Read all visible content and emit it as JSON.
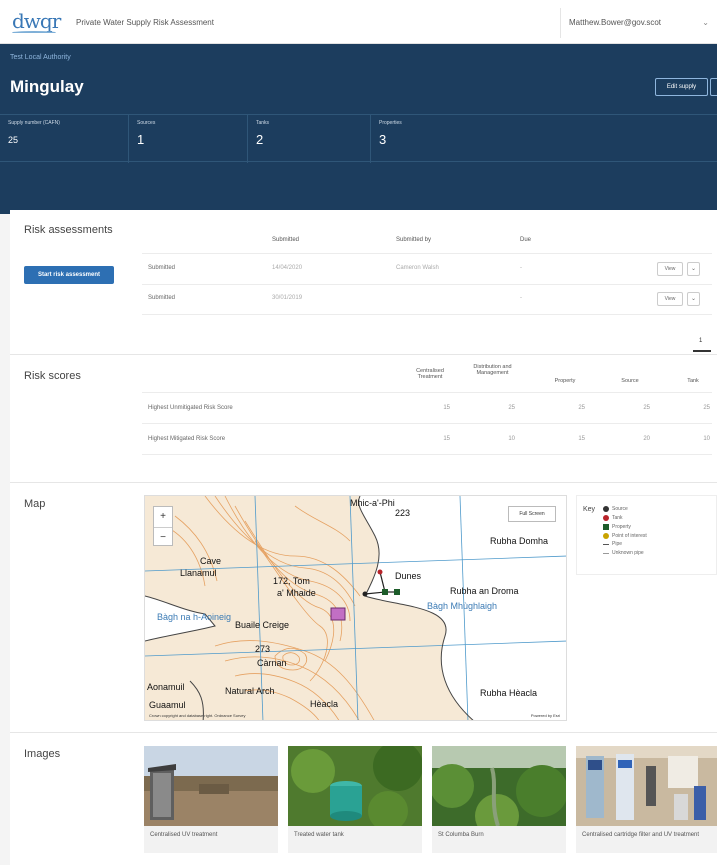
{
  "topbar": {
    "logo": "dwqr",
    "title": "Private Water Supply Risk Assessment",
    "user_email": "Matthew.Bower@gov.scot",
    "chevron": "⌄"
  },
  "header": {
    "authority": "Test Local Authority",
    "supply_name": "Mingulay",
    "edit_label": "Edit supply",
    "stats": [
      {
        "label": "Supply number (CAFN)",
        "value": "25"
      },
      {
        "label": "Sources",
        "value": "1"
      },
      {
        "label": "Tanks",
        "value": "2"
      },
      {
        "label": "Properties",
        "value": "3"
      }
    ]
  },
  "risk_assessments": {
    "title": "Risk assessments",
    "start_label": "Start risk assessment",
    "columns": [
      "Submitted",
      "Submitted by",
      "Due"
    ],
    "rows": [
      {
        "status": "Submitted",
        "submitted": "14/04/2020",
        "by": "Cameron Walsh",
        "due": "-"
      },
      {
        "status": "Submitted",
        "submitted": "30/01/2019",
        "by": "",
        "due": "-"
      }
    ],
    "view_label": "View",
    "caret": "⌄",
    "page": "1"
  },
  "risk_scores": {
    "title": "Risk scores",
    "columns": [
      "Centralised Treatment",
      "Distribution and Management",
      "Property",
      "Source",
      "Tank"
    ],
    "rows": [
      {
        "label": "Highest Unmitigated Risk Score",
        "values": [
          "15",
          "25",
          "25",
          "25",
          "25"
        ]
      },
      {
        "label": "Highest Mitigated Risk Score",
        "values": [
          "15",
          "10",
          "15",
          "20",
          "10"
        ]
      }
    ]
  },
  "map": {
    "title": "Map",
    "zoom_in": "+",
    "zoom_out": "−",
    "fullscreen": "Full Screen",
    "labels": [
      "Mhic-a'-Phi",
      "223",
      "Rubha Domha",
      "Cave",
      "Llanamul",
      "172, Tom",
      "a' Mhaide",
      "Dunes",
      "Rubha an Droma",
      "Bàgh na h-Aoineig",
      "Bàgh Mhùghlaigh",
      "Buaile Creige",
      "273",
      "Càrnan",
      "Natural Arch",
      "Hèacla",
      "Rubha Hèacla",
      "Aonamuil",
      "Guaamul"
    ],
    "attribution": "Crown copyright and database right. Ordnance Survey",
    "powered": "Powered by Esri"
  },
  "key": {
    "title": "Key",
    "items": [
      {
        "label": "Source",
        "color": "#333333"
      },
      {
        "label": "Tank",
        "color": "#b8232a"
      },
      {
        "label": "Property",
        "color": "#1d5c2a"
      },
      {
        "label": "Point of interest",
        "color": "#c9a300"
      },
      {
        "label": "Pipe",
        "color": "#555555"
      },
      {
        "label": "Unknown pipe",
        "color": "#999999"
      }
    ]
  },
  "images": {
    "title": "Images",
    "items": [
      {
        "caption": "Centralised UV treatment",
        "icon": "shed-photo"
      },
      {
        "caption": "Treated water tank",
        "icon": "tank-photo"
      },
      {
        "caption": "St Columba Burn",
        "icon": "burn-photo"
      },
      {
        "caption": "Centralised cartridge filter and UV treatment",
        "icon": "filter-photo"
      }
    ]
  }
}
